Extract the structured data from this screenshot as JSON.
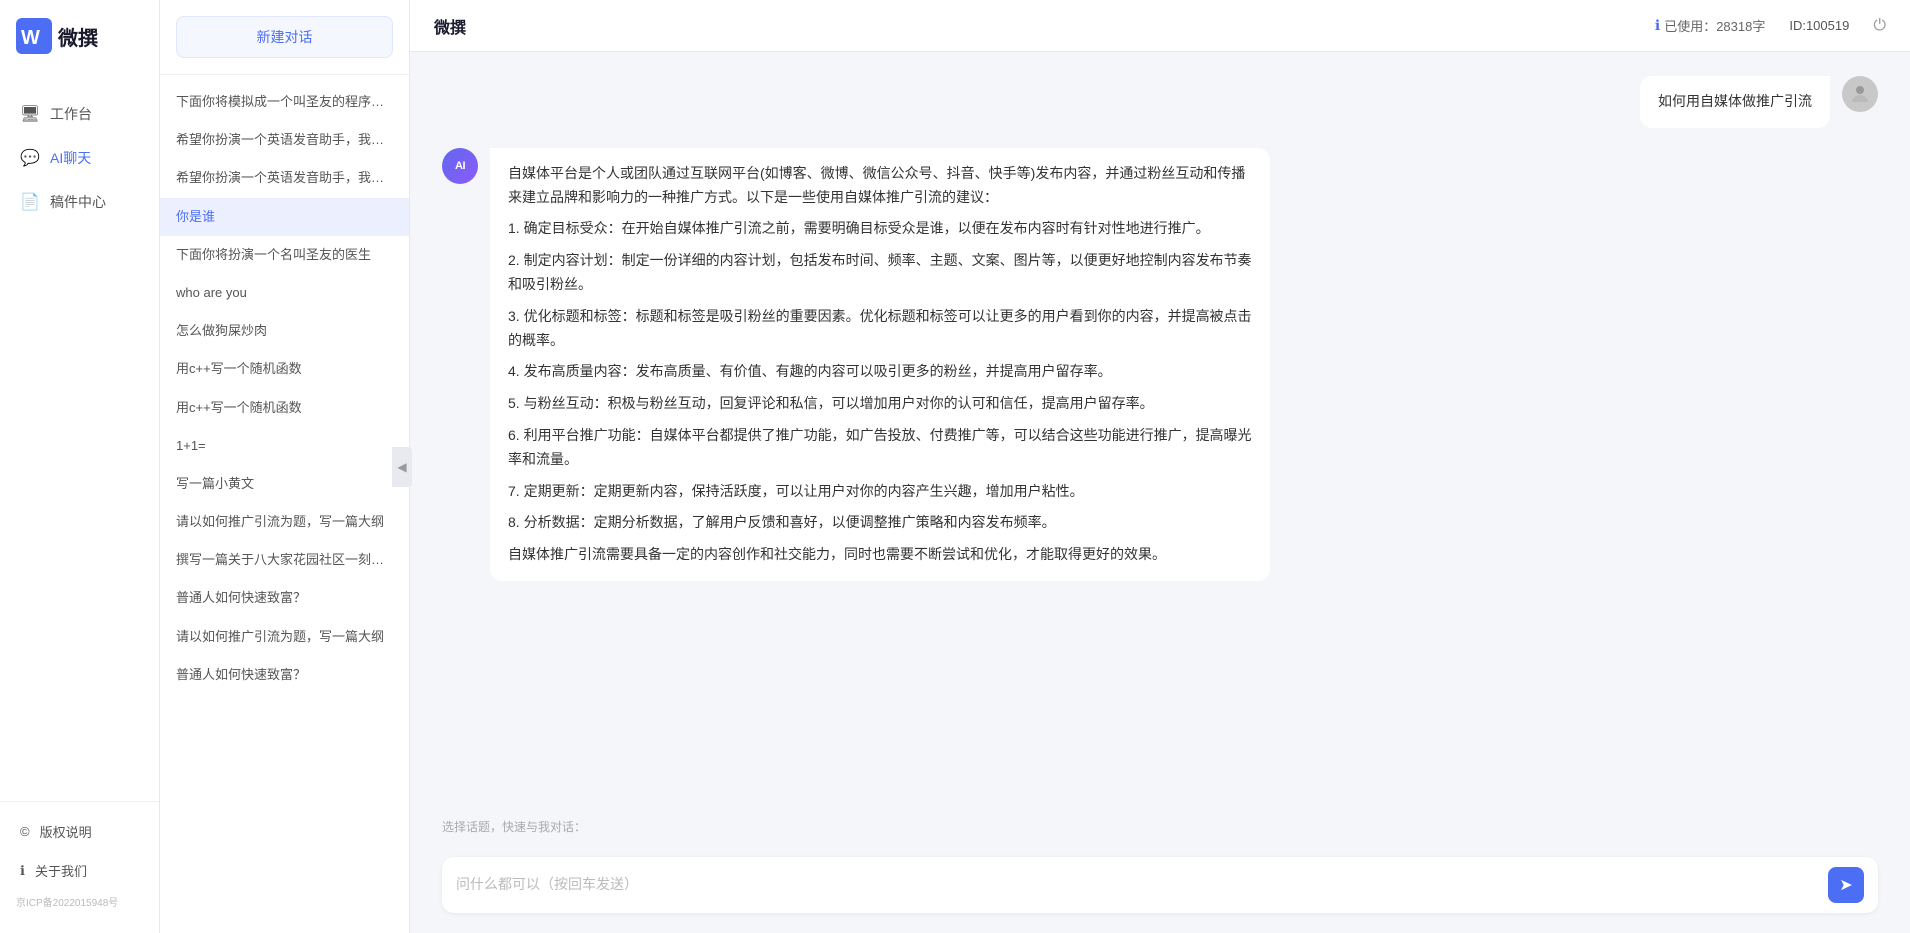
{
  "brand": {
    "title": "微撰",
    "logo_color": "#4B6EF5"
  },
  "header": {
    "title": "微撰",
    "char_count_label": "已使用：28318字",
    "char_count_icon": "ℹ",
    "user_id_label": "ID:100519"
  },
  "nav": {
    "items": [
      {
        "id": "workspace",
        "label": "工作台",
        "icon": "🖥"
      },
      {
        "id": "ai-chat",
        "label": "AI聊天",
        "icon": "💬",
        "active": true
      },
      {
        "id": "components",
        "label": "稿件中心",
        "icon": "📄"
      }
    ],
    "footer": [
      {
        "id": "copyright",
        "label": "版权说明",
        "icon": "©"
      },
      {
        "id": "about",
        "label": "关于我们",
        "icon": "ℹ"
      }
    ],
    "icp": "京ICP备2022015948号"
  },
  "chat_list": {
    "new_chat_label": "新建对话",
    "items": [
      {
        "id": "1",
        "text": "下面你将模拟成一个叫圣友的程序员，我说..."
      },
      {
        "id": "2",
        "text": "希望你扮演一个英语发音助手，我提供给你..."
      },
      {
        "id": "3",
        "text": "希望你扮演一个英语发音助手，我提供给你..."
      },
      {
        "id": "4",
        "text": "你是谁",
        "active": true
      },
      {
        "id": "5",
        "text": "下面你将扮演一个名叫圣友的医生"
      },
      {
        "id": "6",
        "text": "who are you"
      },
      {
        "id": "7",
        "text": "怎么做狗屎炒肉"
      },
      {
        "id": "8",
        "text": "用c++写一个随机函数"
      },
      {
        "id": "9",
        "text": "用c++写一个随机函数"
      },
      {
        "id": "10",
        "text": "1+1="
      },
      {
        "id": "11",
        "text": "写一篇小黄文"
      },
      {
        "id": "12",
        "text": "请以如何推广引流为题，写一篇大纲"
      },
      {
        "id": "13",
        "text": "撰写一篇关于八大家花园社区一刻钟便民生..."
      },
      {
        "id": "14",
        "text": "普通人如何快速致富？"
      },
      {
        "id": "15",
        "text": "请以如何推广引流为题，写一篇大纲"
      },
      {
        "id": "16",
        "text": "普通人如何快速致富？"
      }
    ]
  },
  "messages": [
    {
      "id": "msg1",
      "role": "user",
      "text": "如何用自媒体做推广引流",
      "avatar_type": "user"
    },
    {
      "id": "msg2",
      "role": "assistant",
      "text": "自媒体平台是个人或团队通过互联网平台(如博客、微博、微信公众号、抖音、快手等)发布内容，并通过粉丝互动和传播来建立品牌和影响力的一种推广方式。以下是一些使用自媒体推广引流的建议：\n\n1. 确定目标受众：在开始自媒体推广引流之前，需要明确目标受众是谁，以便在发布内容时有针对性地进行推广。\n\n2. 制定内容计划：制定一份详细的内容计划，包括发布时间、频率、主题、文案、图片等，以便更好地控制内容发布节奏和吸引粉丝。\n\n3. 优化标题和标签：标题和标签是吸引粉丝的重要因素。优化标题和标签可以让更多的用户看到你的内容，并提高被点击的概率。\n\n4. 发布高质量内容：发布高质量、有价值、有趣的内容可以吸引更多的粉丝，并提高用户留存率。\n\n5. 与粉丝互动：积极与粉丝互动，回复评论和私信，可以增加用户对你的认可和信任，提高用户留存率。\n\n6. 利用平台推广功能：自媒体平台都提供了推广功能，如广告投放、付费推广等，可以结合这些功能进行推广，提高曝光率和流量。\n\n7. 定期更新：定期更新内容，保持活跃度，可以让用户对你的内容产生兴趣，增加用户粘性。\n\n8. 分析数据：定期分析数据，了解用户反馈和喜好，以便调整推广策略和内容发布频率。\n\n自媒体推广引流需要具备一定的内容创作和社交能力，同时也需要不断尝试和优化，才能取得更好的效果。",
      "avatar_type": "ai"
    }
  ],
  "input": {
    "placeholder": "问什么都可以（按回车发送）",
    "quick_reply_label": "选择话题，快速与我对话："
  }
}
